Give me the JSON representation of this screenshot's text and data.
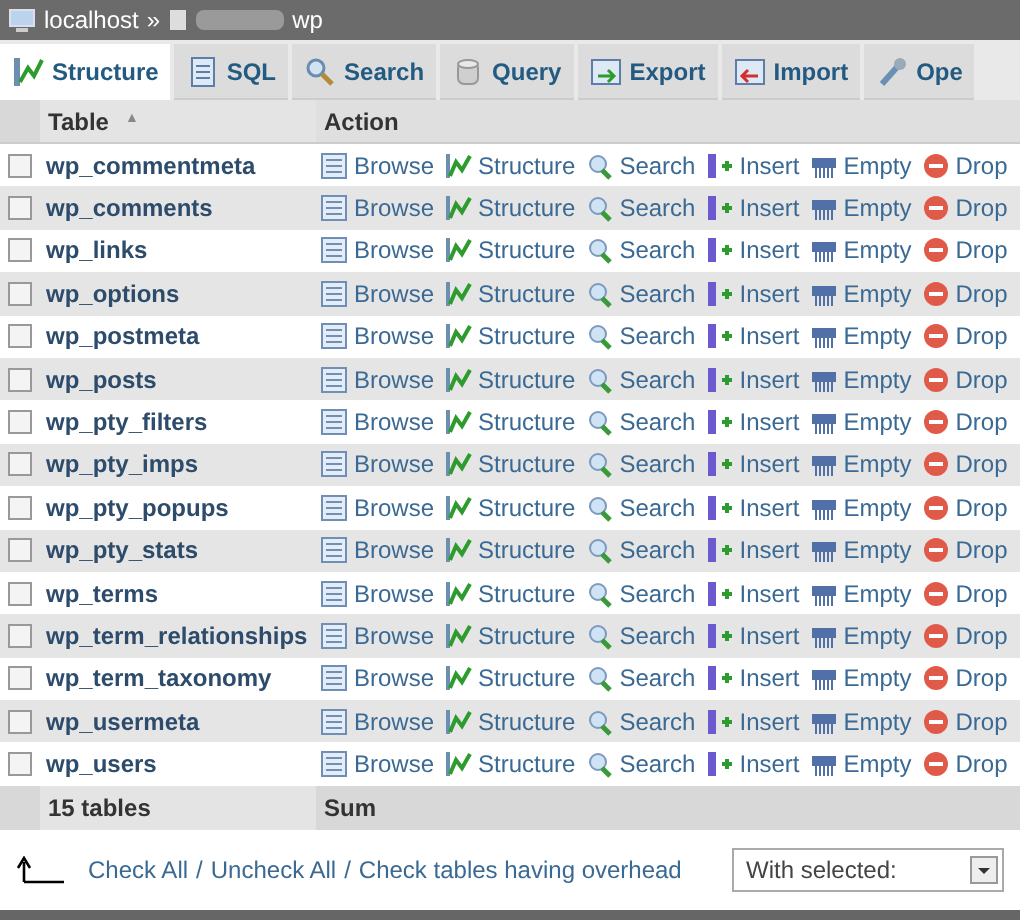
{
  "breadcrumb": {
    "server": "localhost",
    "separator": "»",
    "database": "wp"
  },
  "tabs": [
    {
      "label": "Structure",
      "selected": true
    },
    {
      "label": "SQL",
      "selected": false
    },
    {
      "label": "Search",
      "selected": false
    },
    {
      "label": "Query",
      "selected": false
    },
    {
      "label": "Export",
      "selected": false
    },
    {
      "label": "Import",
      "selected": false
    },
    {
      "label": "Ope",
      "selected": false
    }
  ],
  "table": {
    "columns": [
      "Table",
      "Action"
    ],
    "sort_mark": "▲",
    "rows": [
      {
        "name": "wp_commentmeta",
        "checked": false,
        "actions": [
          "Browse",
          "Structure",
          "Search",
          "Insert",
          "Empty",
          "Drop"
        ]
      },
      {
        "name": "wp_comments",
        "checked": false,
        "actions": [
          "Browse",
          "Structure",
          "Search",
          "Insert",
          "Empty",
          "Drop"
        ]
      },
      {
        "name": "wp_links",
        "checked": false,
        "actions": [
          "Browse",
          "Structure",
          "Search",
          "Insert",
          "Empty",
          "Drop"
        ]
      },
      {
        "name": "wp_options",
        "checked": false,
        "actions": [
          "Browse",
          "Structure",
          "Search",
          "Insert",
          "Empty",
          "Drop"
        ]
      },
      {
        "name": "wp_postmeta",
        "checked": false,
        "actions": [
          "Browse",
          "Structure",
          "Search",
          "Insert",
          "Empty",
          "Drop"
        ]
      },
      {
        "name": "wp_posts",
        "checked": false,
        "actions": [
          "Browse",
          "Structure",
          "Search",
          "Insert",
          "Empty",
          "Drop"
        ]
      },
      {
        "name": "wp_pty_filters",
        "checked": false,
        "actions": [
          "Browse",
          "Structure",
          "Search",
          "Insert",
          "Empty",
          "Drop"
        ]
      },
      {
        "name": "wp_pty_imps",
        "checked": false,
        "actions": [
          "Browse",
          "Structure",
          "Search",
          "Insert",
          "Empty",
          "Drop"
        ]
      },
      {
        "name": "wp_pty_popups",
        "checked": false,
        "actions": [
          "Browse",
          "Structure",
          "Search",
          "Insert",
          "Empty",
          "Drop"
        ]
      },
      {
        "name": "wp_pty_stats",
        "checked": false,
        "actions": [
          "Browse",
          "Structure",
          "Search",
          "Insert",
          "Empty",
          "Drop"
        ]
      },
      {
        "name": "wp_terms",
        "checked": false,
        "actions": [
          "Browse",
          "Structure",
          "Search",
          "Insert",
          "Empty",
          "Drop"
        ]
      },
      {
        "name": "wp_term_relationships",
        "checked": false,
        "actions": [
          "Browse",
          "Structure",
          "Search",
          "Insert",
          "Empty",
          "Drop"
        ]
      },
      {
        "name": "wp_term_taxonomy",
        "checked": false,
        "actions": [
          "Browse",
          "Structure",
          "Search",
          "Insert",
          "Empty",
          "Drop"
        ]
      },
      {
        "name": "wp_usermeta",
        "checked": false,
        "actions": [
          "Browse",
          "Structure",
          "Search",
          "Insert",
          "Empty",
          "Drop"
        ]
      },
      {
        "name": "wp_users",
        "checked": false,
        "actions": [
          "Browse",
          "Structure",
          "Search",
          "Insert",
          "Empty",
          "Drop"
        ]
      }
    ],
    "footer": [
      "15 tables",
      "Sum"
    ]
  },
  "bulk": {
    "links": [
      "Check All",
      "Uncheck All",
      "Check tables having overhead"
    ],
    "separator": "/",
    "select": {
      "value": "With selected:"
    }
  }
}
